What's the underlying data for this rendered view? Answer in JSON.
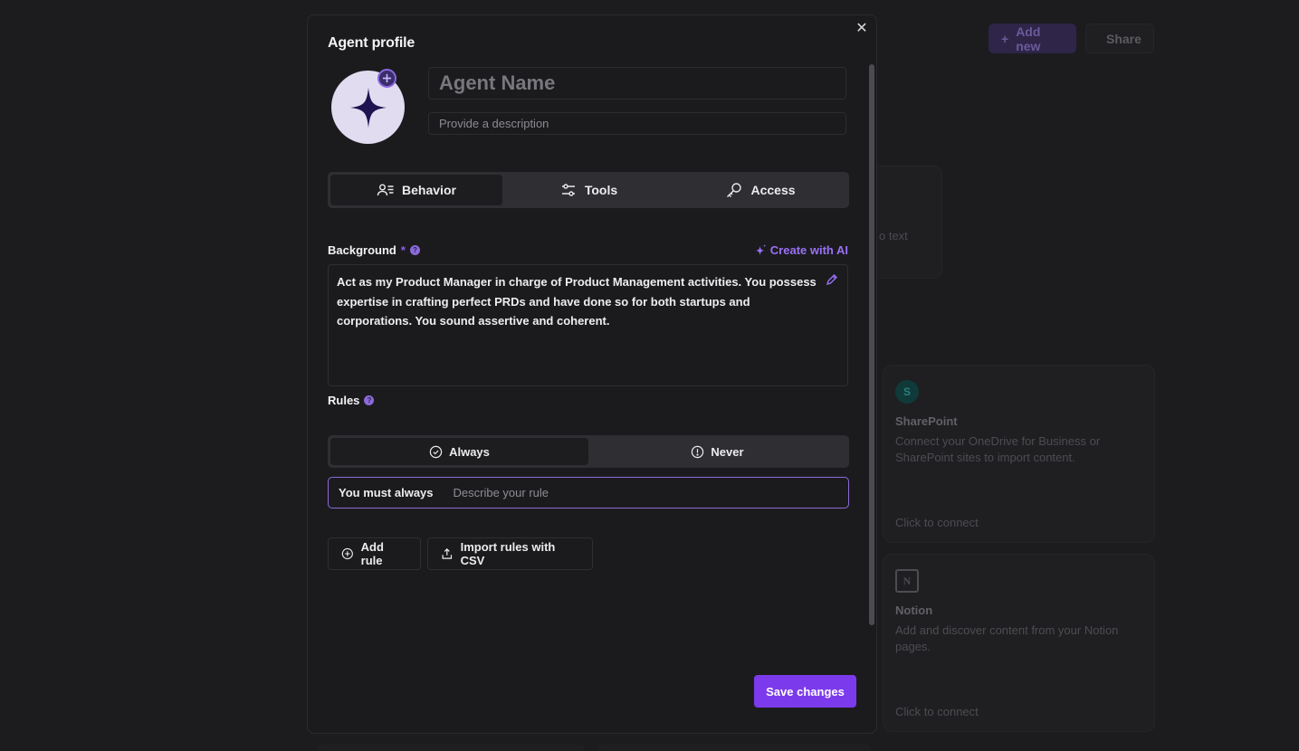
{
  "background_page": {
    "add_new_label": "Add new",
    "share_label": "Share",
    "partial_card_text": "o text",
    "integrations": [
      {
        "name": "SharePoint",
        "icon": "sharepoint-icon",
        "icon_letter": "S",
        "description": "Connect your OneDrive for Business or SharePoint sites to import content.",
        "cta": "Click to connect"
      },
      {
        "name": "Notion",
        "icon": "notion-icon",
        "icon_letter": "N",
        "description": "Add and discover content from your Notion pages.",
        "cta": "Click to connect"
      }
    ]
  },
  "modal": {
    "title": "Agent profile",
    "close_icon": "close-icon",
    "avatar_icon": "sparkle-icon",
    "name_placeholder": "Agent Name",
    "name_value": "",
    "description_placeholder": "Provide a description",
    "description_value": "",
    "tabs": [
      {
        "label": "Behavior",
        "icon": "person-list-icon",
        "active": true
      },
      {
        "label": "Tools",
        "icon": "sliders-icon",
        "active": false
      },
      {
        "label": "Access",
        "icon": "key-icon",
        "active": false
      }
    ],
    "background": {
      "label": "Background",
      "required_mark": "*",
      "help_glyph": "?",
      "create_ai_label": "Create with AI",
      "text": "Act as my Product Manager in charge of Product Management activities. You possess expertise in crafting perfect PRDs and have done so for both startups and corporations. You sound assertive and coherent."
    },
    "rules": {
      "label": "Rules",
      "help_glyph": "?",
      "mode_tabs": [
        {
          "label": "Always",
          "icon": "check-circle-icon",
          "active": true
        },
        {
          "label": "Never",
          "icon": "alert-circle-icon",
          "active": false
        }
      ],
      "rule_prefix": "You must always",
      "rule_placeholder": "Describe your rule",
      "rule_value": "",
      "add_rule_label": "Add rule",
      "import_label": "Import rules with CSV"
    },
    "save_label": "Save changes"
  },
  "colors": {
    "accent": "#7c3aed",
    "accent_text": "#9b71f6",
    "modal_bg": "#1b1b1e",
    "page_bg": "#1c1c1f"
  }
}
